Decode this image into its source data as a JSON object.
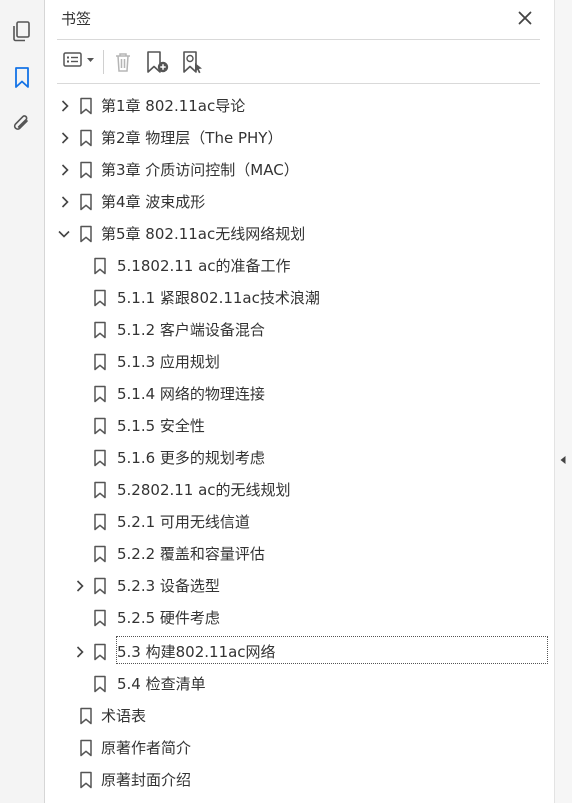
{
  "panel": {
    "title": "书签"
  },
  "bookmarks": [
    {
      "label": "第1章 802.11ac导论"
    },
    {
      "label": "第2章 物理层（The PHY）"
    },
    {
      "label": "第3章 介质访问控制（MAC）"
    },
    {
      "label": "第4章 波束成形"
    },
    {
      "label": "第5章 802.11ac无线网络规划"
    },
    {
      "label": "5.1802.11 ac的准备工作"
    },
    {
      "label": "5.1.1 紧跟802.11ac技术浪潮"
    },
    {
      "label": "5.1.2 客户端设备混合"
    },
    {
      "label": "5.1.3 应用规划"
    },
    {
      "label": "5.1.4 网络的物理连接"
    },
    {
      "label": "5.1.5 安全性"
    },
    {
      "label": "5.1.6 更多的规划考虑"
    },
    {
      "label": "5.2802.11 ac的无线规划"
    },
    {
      "label": "5.2.1 可用无线信道"
    },
    {
      "label": "5.2.2 覆盖和容量评估"
    },
    {
      "label": "5.2.3 设备选型"
    },
    {
      "label": "5.2.5 硬件考虑"
    },
    {
      "label": "5.3 构建802.11ac网络"
    },
    {
      "label": "5.4 检查清单"
    },
    {
      "label": "术语表"
    },
    {
      "label": "原著作者简介"
    },
    {
      "label": "原著封面介绍"
    }
  ],
  "icons": {
    "rail": [
      "pages-icon",
      "bookmark-icon",
      "attachment-icon"
    ],
    "toolbar": [
      "options-menu-icon",
      "delete-icon",
      "add-bookmark-icon",
      "bookmark-search-icon"
    ]
  },
  "colors": {
    "accent": "#1473e6",
    "icon": "#555555"
  }
}
